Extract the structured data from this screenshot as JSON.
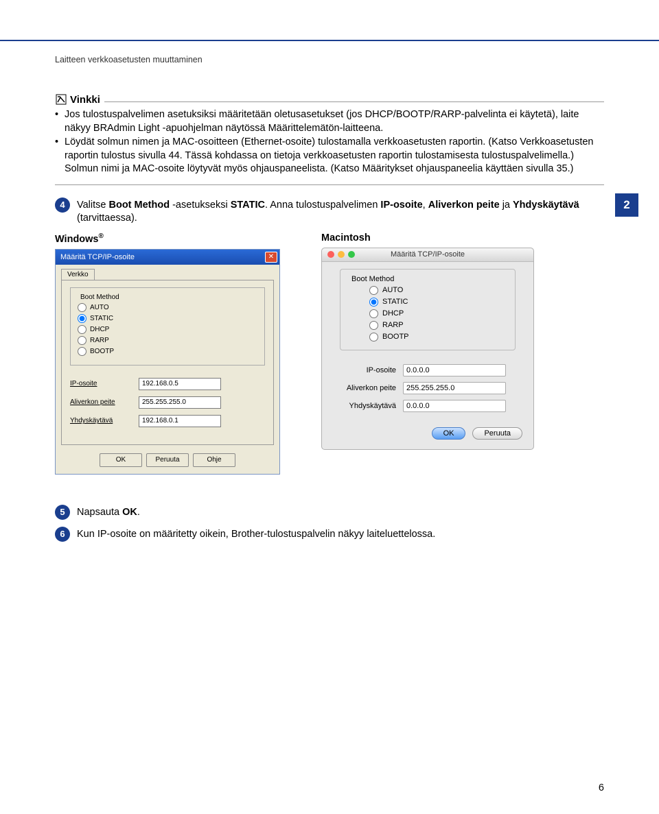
{
  "header_title": "Laitteen verkkoasetusten muuttaminen",
  "side_tab": "2",
  "note": {
    "title": "Vinkki",
    "bullets": [
      "Jos tulostuspalvelimen asetuksiksi määritetään oletusasetukset (jos DHCP/BOOTP/RARP-palvelinta ei käytetä), laite näkyy BRAdmin Light -apuohjelman näytössä Määrittelemätön-laitteena.",
      "Löydät solmun nimen ja MAC-osoitteen (Ethernet-osoite) tulostamalla verkkoasetusten raportin. (Katso Verkkoasetusten raportin tulostus sivulla 44. Tässä kohdassa on tietoja verkkoasetusten raportin tulostamisesta tulostuspalvelimella.) Solmun nimi ja MAC-osoite löytyvät myös ohjauspaneelista. (Katso Määritykset ohjauspaneelia käyttäen sivulla 35.)"
    ]
  },
  "steps": {
    "s4_num": "4",
    "s4_text": "Valitse Boot Method -asetukseksi STATIC. Anna tulostuspalvelimen IP-osoite, Aliverkon peite ja Yhdyskäytävä (tarvittaessa).",
    "s5_num": "5",
    "s5_text": "Napsauta OK.",
    "s6_num": "6",
    "s6_text": "Kun IP-osoite on määritetty oikein, Brother-tulostuspalvelin näkyy laiteluettelossa."
  },
  "os": {
    "windows_label": "Windows",
    "windows_reg": "®",
    "mac_label": "Macintosh"
  },
  "win": {
    "title": "Määritä TCP/IP-osoite",
    "tab": "Verkko",
    "bootmethod": "Boot Method",
    "auto": "AUTO",
    "static": "STATIC",
    "dhcp": "DHCP",
    "rarp": "RARP",
    "bootp": "BOOTP",
    "ip_label": "IP-osoite",
    "ip_value": "192.168.0.5",
    "mask_label": "Aliverkon peite",
    "mask_value": "255.255.255.0",
    "gw_label": "Yhdyskäytävä",
    "gw_value": "192.168.0.1",
    "ok": "OK",
    "cancel": "Peruuta",
    "help": "Ohje"
  },
  "mac": {
    "title": "Määritä TCP/IP-osoite",
    "bootmethod": "Boot Method",
    "auto": "AUTO",
    "static": "STATIC",
    "dhcp": "DHCP",
    "rarp": "RARP",
    "bootp": "BOOTP",
    "ip_label": "IP-osoite",
    "ip_value": "0.0.0.0",
    "mask_label": "Aliverkon peite",
    "mask_value": "255.255.255.0",
    "gw_label": "Yhdyskäytävä",
    "gw_value": "0.0.0.0",
    "ok": "OK",
    "cancel": "Peruuta"
  },
  "page_number": "6"
}
